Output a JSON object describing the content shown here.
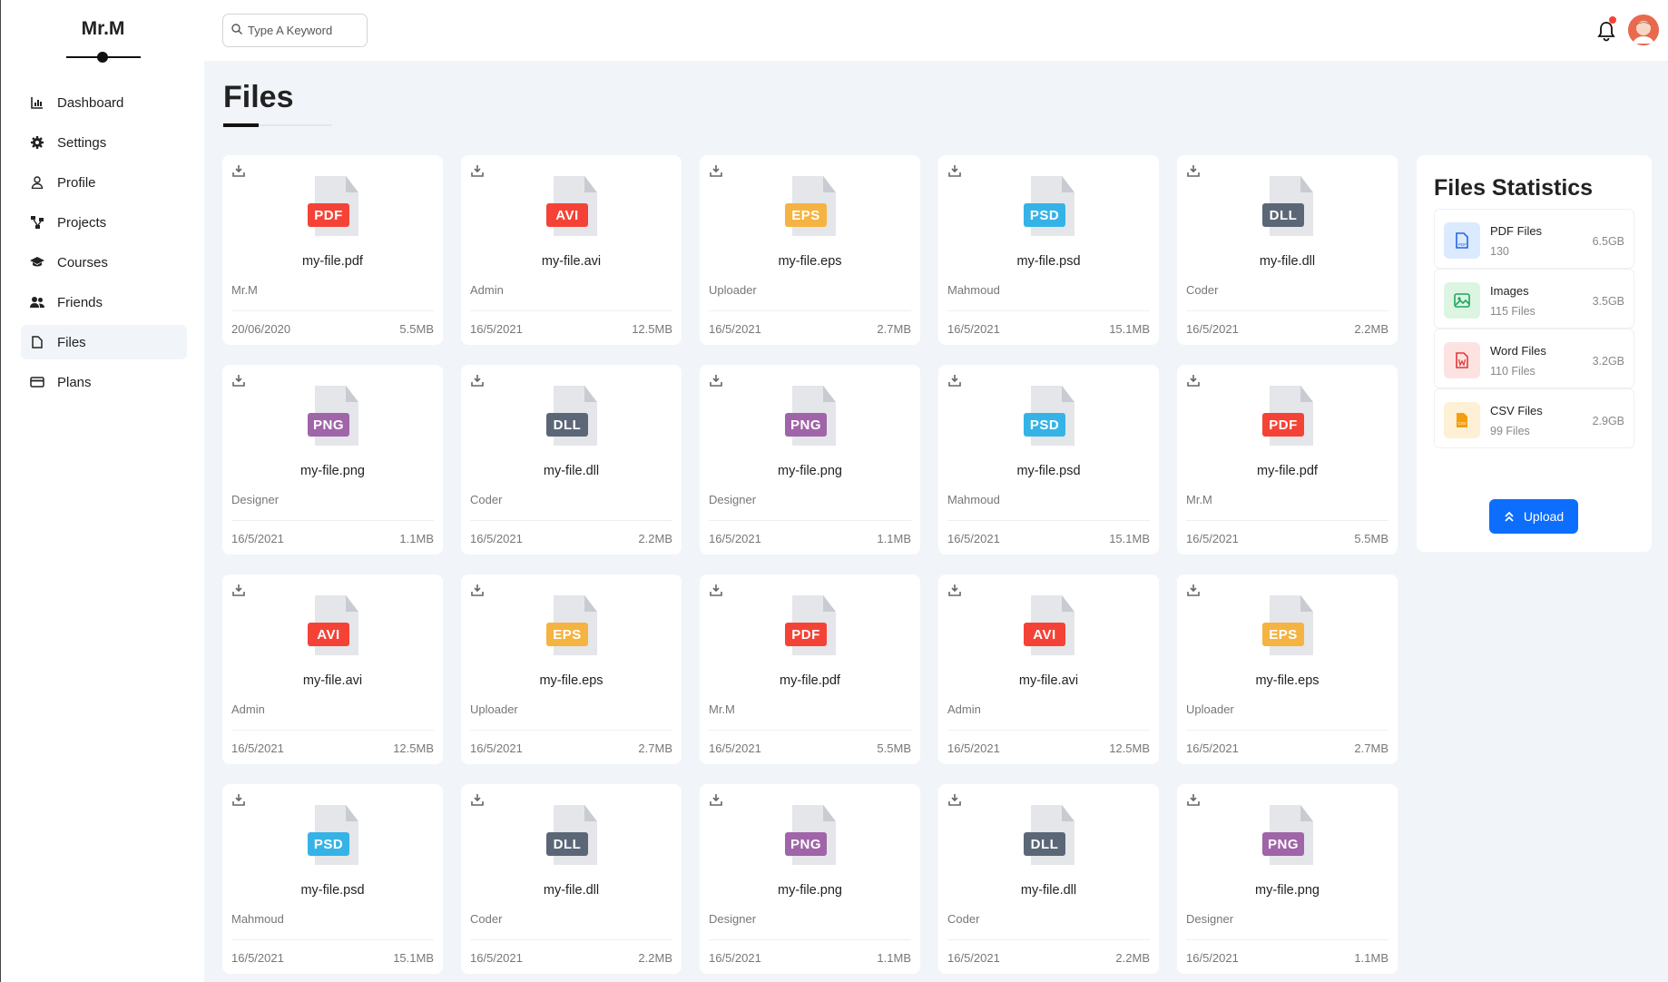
{
  "sidebar": {
    "brand": "Mr.M",
    "items": [
      {
        "label": "Dashboard",
        "icon": "chart-icon"
      },
      {
        "label": "Settings",
        "icon": "gear-icon"
      },
      {
        "label": "Profile",
        "icon": "user-icon"
      },
      {
        "label": "Projects",
        "icon": "diagram-icon"
      },
      {
        "label": "Courses",
        "icon": "graduation-cap-icon"
      },
      {
        "label": "Friends",
        "icon": "users-icon"
      },
      {
        "label": "Files",
        "icon": "file-icon",
        "active": true
      },
      {
        "label": "Plans",
        "icon": "credit-card-icon"
      }
    ]
  },
  "header": {
    "search_placeholder": "Type A Keyword",
    "notification_dot_color": "#f44336"
  },
  "page": {
    "title": "Files"
  },
  "type_colors": {
    "PDF": "#f44336",
    "AVI": "#f44336",
    "EPS": "#f5b342",
    "PSD": "#36b3e6",
    "DLL": "#5b6777",
    "PNG": "#a064a8"
  },
  "files": [
    {
      "type": "PDF",
      "name": "my-file.pdf",
      "owner": "Mr.M",
      "date": "20/06/2020",
      "size": "5.5MB"
    },
    {
      "type": "AVI",
      "name": "my-file.avi",
      "owner": "Admin",
      "date": "16/5/2021",
      "size": "12.5MB"
    },
    {
      "type": "EPS",
      "name": "my-file.eps",
      "owner": "Uploader",
      "date": "16/5/2021",
      "size": "2.7MB"
    },
    {
      "type": "PSD",
      "name": "my-file.psd",
      "owner": "Mahmoud",
      "date": "16/5/2021",
      "size": "15.1MB"
    },
    {
      "type": "DLL",
      "name": "my-file.dll",
      "owner": "Coder",
      "date": "16/5/2021",
      "size": "2.2MB"
    },
    {
      "type": "PNG",
      "name": "my-file.png",
      "owner": "Designer",
      "date": "16/5/2021",
      "size": "1.1MB"
    },
    {
      "type": "DLL",
      "name": "my-file.dll",
      "owner": "Coder",
      "date": "16/5/2021",
      "size": "2.2MB"
    },
    {
      "type": "PNG",
      "name": "my-file.png",
      "owner": "Designer",
      "date": "16/5/2021",
      "size": "1.1MB"
    },
    {
      "type": "PSD",
      "name": "my-file.psd",
      "owner": "Mahmoud",
      "date": "16/5/2021",
      "size": "15.1MB"
    },
    {
      "type": "PDF",
      "name": "my-file.pdf",
      "owner": "Mr.M",
      "date": "16/5/2021",
      "size": "5.5MB"
    },
    {
      "type": "AVI",
      "name": "my-file.avi",
      "owner": "Admin",
      "date": "16/5/2021",
      "size": "12.5MB"
    },
    {
      "type": "EPS",
      "name": "my-file.eps",
      "owner": "Uploader",
      "date": "16/5/2021",
      "size": "2.7MB"
    },
    {
      "type": "PDF",
      "name": "my-file.pdf",
      "owner": "Mr.M",
      "date": "16/5/2021",
      "size": "5.5MB"
    },
    {
      "type": "AVI",
      "name": "my-file.avi",
      "owner": "Admin",
      "date": "16/5/2021",
      "size": "12.5MB"
    },
    {
      "type": "EPS",
      "name": "my-file.eps",
      "owner": "Uploader",
      "date": "16/5/2021",
      "size": "2.7MB"
    },
    {
      "type": "PSD",
      "name": "my-file.psd",
      "owner": "Mahmoud",
      "date": "16/5/2021",
      "size": "15.1MB"
    },
    {
      "type": "DLL",
      "name": "my-file.dll",
      "owner": "Coder",
      "date": "16/5/2021",
      "size": "2.2MB"
    },
    {
      "type": "PNG",
      "name": "my-file.png",
      "owner": "Designer",
      "date": "16/5/2021",
      "size": "1.1MB"
    },
    {
      "type": "DLL",
      "name": "my-file.dll",
      "owner": "Coder",
      "date": "16/5/2021",
      "size": "2.2MB"
    },
    {
      "type": "PNG",
      "name": "my-file.png",
      "owner": "Designer",
      "date": "16/5/2021",
      "size": "1.1MB"
    }
  ],
  "stats": {
    "title": "Files Statistics",
    "items": [
      {
        "name": "PDF Files",
        "count": "130",
        "size": "6.5GB",
        "icon": "pdf-icon",
        "bg": "#dbeafe",
        "fg": "#2563eb"
      },
      {
        "name": "Images",
        "count": "115 Files",
        "size": "3.5GB",
        "icon": "image-icon",
        "bg": "#dcf5e3",
        "fg": "#22a55a"
      },
      {
        "name": "Word Files",
        "count": "110 Files",
        "size": "3.2GB",
        "icon": "word-icon",
        "bg": "#fde2e2",
        "fg": "#e53935"
      },
      {
        "name": "CSV Files",
        "count": "99 Files",
        "size": "2.9GB",
        "icon": "csv-icon",
        "bg": "#fdf0d5",
        "fg": "#f59e0b"
      }
    ],
    "upload_label": "Upload"
  }
}
